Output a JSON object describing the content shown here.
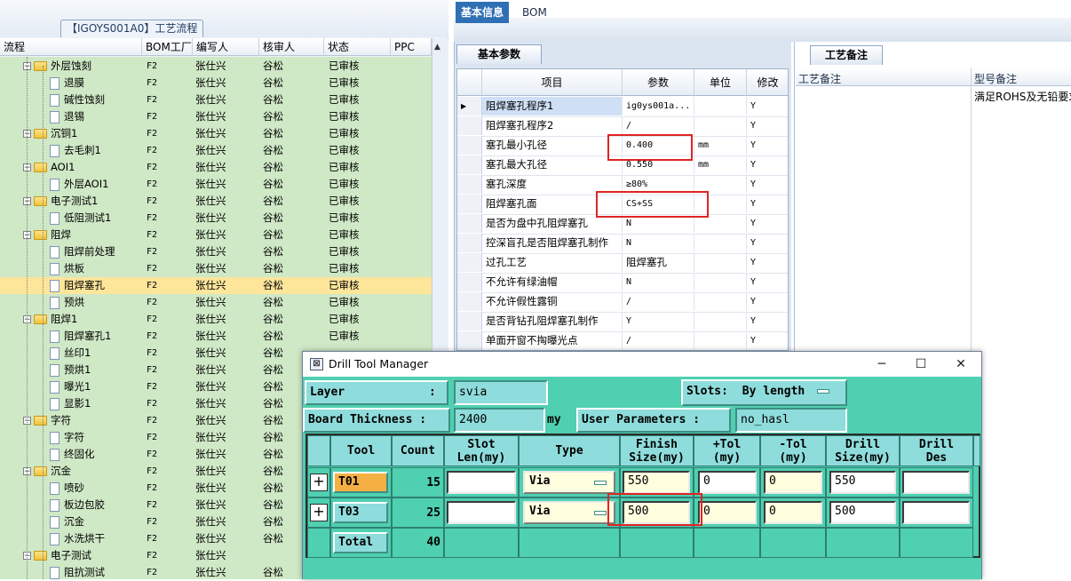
{
  "left_panel": {
    "title": "【IGOYS001A0】工艺流程",
    "columns": [
      "流程",
      "BOM工厂",
      "编写人",
      "核审人",
      "状态",
      "PPC"
    ],
    "rows": [
      {
        "level": 1,
        "type": "folder",
        "expanded": true,
        "name": "外层蚀刻",
        "bom": "F2",
        "writer": "张仕兴",
        "reviewer": "谷松",
        "status": "已审核"
      },
      {
        "level": 2,
        "type": "doc",
        "name": "退膜",
        "bom": "F2",
        "writer": "张仕兴",
        "reviewer": "谷松",
        "status": "已审核"
      },
      {
        "level": 2,
        "type": "doc",
        "name": "碱性蚀刻",
        "bom": "F2",
        "writer": "张仕兴",
        "reviewer": "谷松",
        "status": "已审核"
      },
      {
        "level": 2,
        "type": "doc",
        "name": "退锡",
        "bom": "F2",
        "writer": "张仕兴",
        "reviewer": "谷松",
        "status": "已审核"
      },
      {
        "level": 1,
        "type": "folder",
        "expanded": true,
        "name": "沉铜1",
        "bom": "F2",
        "writer": "张仕兴",
        "reviewer": "谷松",
        "status": "已审核"
      },
      {
        "level": 2,
        "type": "doc",
        "name": "去毛刺1",
        "bom": "F2",
        "writer": "张仕兴",
        "reviewer": "谷松",
        "status": "已审核"
      },
      {
        "level": 1,
        "type": "folder",
        "expanded": true,
        "name": "AOI1",
        "bom": "F2",
        "writer": "张仕兴",
        "reviewer": "谷松",
        "status": "已审核"
      },
      {
        "level": 2,
        "type": "doc",
        "name": "外层AOI1",
        "bom": "F2",
        "writer": "张仕兴",
        "reviewer": "谷松",
        "status": "已审核"
      },
      {
        "level": 1,
        "type": "folder",
        "expanded": true,
        "name": "电子测试1",
        "bom": "F2",
        "writer": "张仕兴",
        "reviewer": "谷松",
        "status": "已审核"
      },
      {
        "level": 2,
        "type": "doc",
        "name": "低阻测试1",
        "bom": "F2",
        "writer": "张仕兴",
        "reviewer": "谷松",
        "status": "已审核"
      },
      {
        "level": 1,
        "type": "folder",
        "expanded": true,
        "name": "阻焊",
        "bom": "F2",
        "writer": "张仕兴",
        "reviewer": "谷松",
        "status": "已审核"
      },
      {
        "level": 2,
        "type": "doc",
        "name": "阻焊前处理",
        "bom": "F2",
        "writer": "张仕兴",
        "reviewer": "谷松",
        "status": "已审核"
      },
      {
        "level": 2,
        "type": "doc",
        "name": "烘板",
        "bom": "F2",
        "writer": "张仕兴",
        "reviewer": "谷松",
        "status": "已审核"
      },
      {
        "level": 2,
        "type": "doc",
        "name": "阻焊塞孔",
        "bom": "F2",
        "writer": "张仕兴",
        "reviewer": "谷松",
        "status": "已审核",
        "selected": true
      },
      {
        "level": 2,
        "type": "doc",
        "name": "预烘",
        "bom": "F2",
        "writer": "张仕兴",
        "reviewer": "谷松",
        "status": "已审核"
      },
      {
        "level": 1,
        "type": "folder",
        "expanded": true,
        "name": "阻焊1",
        "bom": "F2",
        "writer": "张仕兴",
        "reviewer": "谷松",
        "status": "已审核"
      },
      {
        "level": 2,
        "type": "doc",
        "name": "阻焊塞孔1",
        "bom": "F2",
        "writer": "张仕兴",
        "reviewer": "谷松",
        "status": "已审核"
      },
      {
        "level": 2,
        "type": "doc",
        "name": "丝印1",
        "bom": "F2",
        "writer": "张仕兴",
        "reviewer": "谷松",
        "status": ""
      },
      {
        "level": 2,
        "type": "doc",
        "name": "预烘1",
        "bom": "F2",
        "writer": "张仕兴",
        "reviewer": "谷松",
        "status": ""
      },
      {
        "level": 2,
        "type": "doc",
        "name": "曝光1",
        "bom": "F2",
        "writer": "张仕兴",
        "reviewer": "谷松",
        "status": ""
      },
      {
        "level": 2,
        "type": "doc",
        "name": "显影1",
        "bom": "F2",
        "writer": "张仕兴",
        "reviewer": "谷松",
        "status": ""
      },
      {
        "level": 1,
        "type": "folder",
        "expanded": true,
        "name": "字符",
        "bom": "F2",
        "writer": "张仕兴",
        "reviewer": "谷松",
        "status": ""
      },
      {
        "level": 2,
        "type": "doc",
        "name": "字符",
        "bom": "F2",
        "writer": "张仕兴",
        "reviewer": "谷松",
        "status": ""
      },
      {
        "level": 2,
        "type": "doc",
        "name": "终固化",
        "bom": "F2",
        "writer": "张仕兴",
        "reviewer": "谷松",
        "status": ""
      },
      {
        "level": 1,
        "type": "folder",
        "expanded": true,
        "name": "沉金",
        "bom": "F2",
        "writer": "张仕兴",
        "reviewer": "谷松",
        "status": ""
      },
      {
        "level": 2,
        "type": "doc",
        "name": "喷砂",
        "bom": "F2",
        "writer": "张仕兴",
        "reviewer": "谷松",
        "status": ""
      },
      {
        "level": 2,
        "type": "doc",
        "name": "板边包胶",
        "bom": "F2",
        "writer": "张仕兴",
        "reviewer": "谷松",
        "status": ""
      },
      {
        "level": 2,
        "type": "doc",
        "name": "沉金",
        "bom": "F2",
        "writer": "张仕兴",
        "reviewer": "谷松",
        "status": ""
      },
      {
        "level": 2,
        "type": "doc",
        "name": "水洗烘干",
        "bom": "F2",
        "writer": "张仕兴",
        "reviewer": "谷松",
        "status": ""
      },
      {
        "level": 1,
        "type": "folder",
        "expanded": true,
        "name": "电子测试",
        "bom": "F2",
        "writer": "张仕兴",
        "reviewer": "",
        "status": ""
      },
      {
        "level": 2,
        "type": "doc",
        "name": "阻抗测试",
        "bom": "F2",
        "writer": "张仕兴",
        "reviewer": "谷松",
        "status": ""
      }
    ]
  },
  "tabs": {
    "basic": "基本信息",
    "bom": "BOM"
  },
  "basic_params": {
    "subtab": "基本参数",
    "columns": [
      "项目",
      "参数",
      "单位",
      "修改"
    ],
    "rows": [
      {
        "item": "阻焊塞孔程序1",
        "param": "ig0ys001a...",
        "unit": "",
        "mod": "Y",
        "current": true
      },
      {
        "item": "阻焊塞孔程序2",
        "param": "/",
        "unit": "",
        "mod": "Y"
      },
      {
        "item": "塞孔最小孔径",
        "param": "0.400",
        "unit": "mm",
        "mod": "Y"
      },
      {
        "item": "塞孔最大孔径",
        "param": "0.550",
        "unit": "mm",
        "mod": "Y"
      },
      {
        "item": "塞孔深度",
        "param": "≥80%",
        "unit": "",
        "mod": "Y"
      },
      {
        "item": "阻焊塞孔面",
        "param": "CS+SS",
        "unit": "",
        "mod": "Y"
      },
      {
        "item": "是否为盘中孔阻焊塞孔",
        "param": "N",
        "unit": "",
        "mod": "Y"
      },
      {
        "item": "控深盲孔是否阻焊塞孔制作",
        "param": "N",
        "unit": "",
        "mod": "Y"
      },
      {
        "item": "过孔工艺",
        "param": "阻焊塞孔",
        "unit": "",
        "mod": "Y"
      },
      {
        "item": "不允许有绿油帽",
        "param": "N",
        "unit": "",
        "mod": "Y"
      },
      {
        "item": "不允许假性露铜",
        "param": "/",
        "unit": "",
        "mod": "Y"
      },
      {
        "item": "是否背钻孔阻焊塞孔制作",
        "param": "Y",
        "unit": "",
        "mod": "Y"
      },
      {
        "item": "单面开窗不掏曝光点",
        "param": "/",
        "unit": "",
        "mod": "Y"
      }
    ]
  },
  "notes": {
    "tab": "工艺备注",
    "col1": "工艺备注",
    "col2": "型号备注",
    "model_note": "满足ROHS及无铅要求"
  },
  "drill_tool_manager": {
    "title": "Drill Tool Manager",
    "minimize": "─",
    "maximize": "☐",
    "close": "✕",
    "layer_label": "Layer",
    "colon": ":",
    "layer_value": "svia",
    "slots_label": "Slots:",
    "slots_value": "By length",
    "board_thickness_label": "Board Thickness :",
    "board_thickness_value": "2400",
    "board_thickness_unit": "my",
    "user_params_label": "User Parameters :",
    "user_params_value": "no_hasl",
    "columns": [
      {
        "l1": "Tool",
        "l2": ""
      },
      {
        "l1": "Count",
        "l2": ""
      },
      {
        "l1": "Slot",
        "l2": "Len(my)"
      },
      {
        "l1": "Type",
        "l2": ""
      },
      {
        "l1": "Finish",
        "l2": "Size(my)"
      },
      {
        "l1": "+Tol",
        "l2": "(my)"
      },
      {
        "l1": "-Tol",
        "l2": "(my)"
      },
      {
        "l1": "Drill",
        "l2": "Size(my)"
      },
      {
        "l1": "Drill",
        "l2": "Des"
      }
    ],
    "tools": [
      {
        "tool": "T01",
        "count": "15",
        "type": "Via",
        "finish": "550",
        "plus_tol": "0",
        "minus_tol": "0",
        "drill": "550",
        "selected": true
      },
      {
        "tool": "T03",
        "count": "25",
        "type": "Via",
        "finish": "500",
        "plus_tol": "0",
        "minus_tol": "0",
        "drill": "500",
        "selected": false
      }
    ],
    "total_label": "Total",
    "total_count": "40"
  },
  "colors": {
    "tree_bg": "#cfe8c6",
    "selected_row": "#fde59a",
    "dtm_bg": "#4fd0b0",
    "highlight_red": "#e02424",
    "tab_active": "#2f6fb4"
  }
}
